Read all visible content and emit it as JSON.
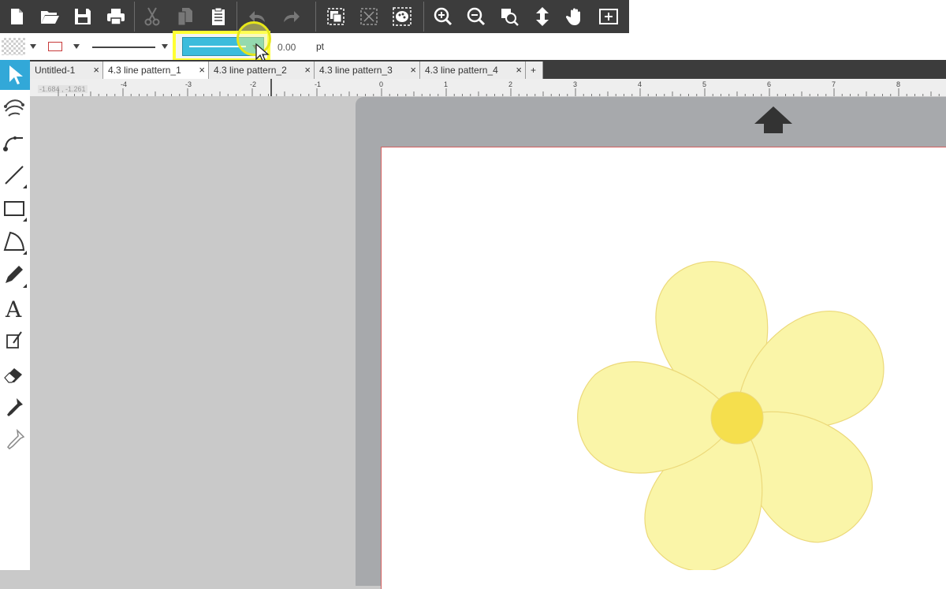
{
  "main_toolbar": {
    "buttons": [
      {
        "name": "new-document"
      },
      {
        "name": "open"
      },
      {
        "name": "save"
      },
      {
        "name": "print"
      },
      {
        "name": "cut"
      },
      {
        "name": "copy"
      },
      {
        "name": "paste"
      },
      {
        "name": "undo"
      },
      {
        "name": "redo"
      },
      {
        "name": "group"
      },
      {
        "name": "ungroup"
      },
      {
        "name": "fill-pattern"
      },
      {
        "name": "zoom-in"
      },
      {
        "name": "zoom-out"
      },
      {
        "name": "zoom-select"
      },
      {
        "name": "move-page"
      },
      {
        "name": "pan"
      },
      {
        "name": "fit-to-window"
      }
    ]
  },
  "line_options": {
    "line_width_value": "0.00",
    "line_width_unit": "pt",
    "selected_line_color": "#3cbcdc",
    "line_color_outline": "#c73a3a",
    "highlight_color": "#ffff33"
  },
  "tools": [
    "select",
    "edit-points",
    "line-point",
    "line",
    "rectangle",
    "polygon",
    "draw",
    "text",
    "knife",
    "eraser",
    "eyedropper",
    "paint-bucket"
  ],
  "tabs": [
    {
      "label": "Untitled-1",
      "close": "×"
    },
    {
      "label": "4.3 line pattern_1",
      "close": "×"
    },
    {
      "label": "4.3 line pattern_2",
      "close": "×"
    },
    {
      "label": "4.3 line pattern_3",
      "close": "×"
    },
    {
      "label": "4.3 line pattern_4",
      "close": "×"
    },
    {
      "label": "+"
    }
  ],
  "ruler": {
    "coords": "-1.684 , -1.261",
    "labels": [
      "-4",
      "-3",
      "-2",
      "-1",
      "0",
      "1",
      "2",
      "3",
      "4",
      "5",
      "6",
      "7",
      "8"
    ]
  },
  "canvas": {
    "flower_petal_color": "#faf5a8",
    "flower_petal_stroke": "#ecd97a",
    "flower_center_color": "#f5df4d"
  }
}
